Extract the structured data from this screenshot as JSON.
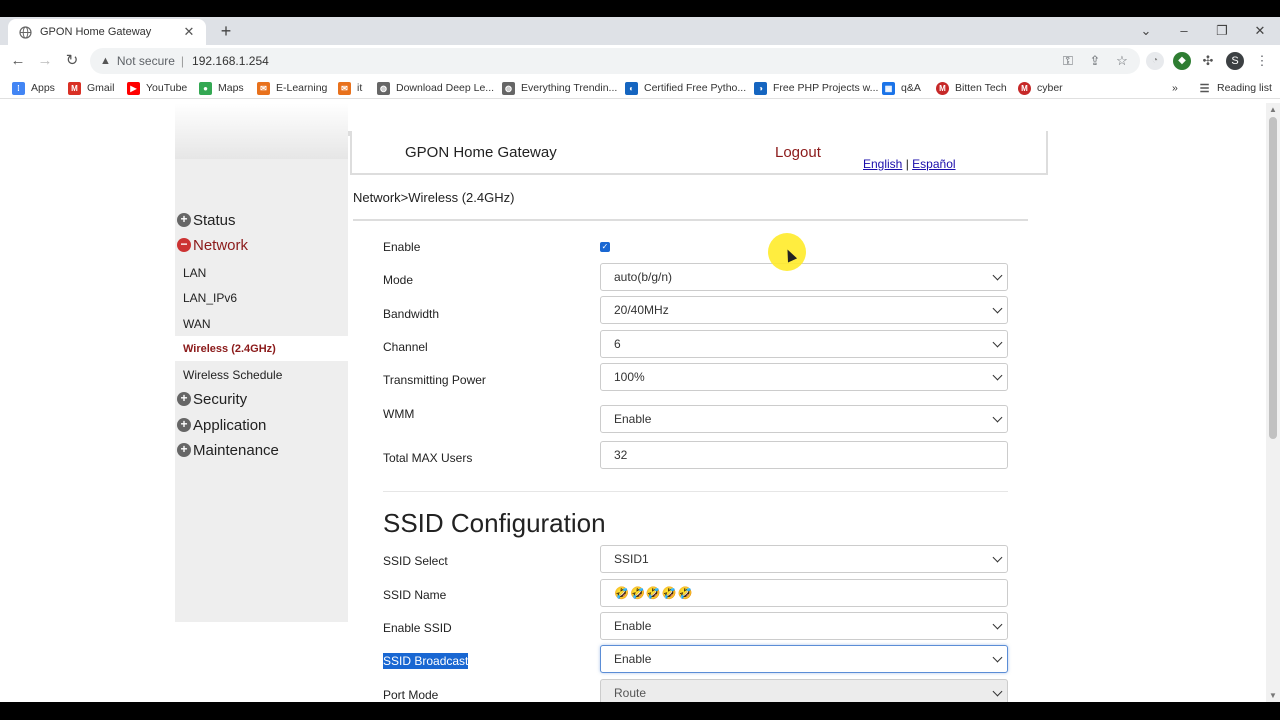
{
  "browser": {
    "tab_title": "GPON Home Gateway",
    "not_secure": "Not secure",
    "url": "192.168.1.254",
    "profile_initial": "S",
    "bookmarks": [
      {
        "label": "Apps",
        "color": "#4285f4"
      },
      {
        "label": "Gmail",
        "color": "#d93025"
      },
      {
        "label": "YouTube",
        "color": "#ff0000"
      },
      {
        "label": "Maps",
        "color": "#34a853"
      },
      {
        "label": "E-Learning",
        "color": "#e8711c"
      },
      {
        "label": "it",
        "color": "#e8711c"
      },
      {
        "label": "Download Deep Le...",
        "color": "#666666"
      },
      {
        "label": "Everything Trendin...",
        "color": "#666666"
      },
      {
        "label": "Certified Free Pytho...",
        "color": "#1565c0"
      },
      {
        "label": "Free PHP Projects w...",
        "color": "#1565c0"
      },
      {
        "label": "q&A",
        "color": "#1a73e8"
      },
      {
        "label": "Bitten Tech",
        "color": "#c62828"
      },
      {
        "label": "cyber",
        "color": "#c62828"
      }
    ],
    "more_bookmarks": "»",
    "reading_list": "Reading list"
  },
  "header": {
    "brand": "GPON Home Gateway",
    "logout": "Logout",
    "lang_en": "English",
    "lang_sep": "|",
    "lang_es": "Español"
  },
  "sidebar": {
    "status": "Status",
    "network": "Network",
    "sub": {
      "lan": "LAN",
      "lan_ipv6": "LAN_IPv6",
      "wan": "WAN",
      "wireless": "Wireless (2.4GHz)",
      "schedule": "Wireless Schedule"
    },
    "security": "Security",
    "application": "Application",
    "maintenance": "Maintenance"
  },
  "breadcrumb": "Network>Wireless (2.4GHz)",
  "wireless": {
    "enable_label": "Enable",
    "enable_checked": true,
    "mode_label": "Mode",
    "mode_value": "auto(b/g/n)",
    "bandwidth_label": "Bandwidth",
    "bandwidth_value": "20/40MHz",
    "channel_label": "Channel",
    "channel_value": "6",
    "power_label": "Transmitting Power",
    "power_value": "100%",
    "wmm_label": "WMM",
    "wmm_value": "Enable",
    "max_users_label": "Total MAX Users",
    "max_users_value": "32"
  },
  "ssid": {
    "section_title": "SSID Configuration",
    "select_label": "SSID Select",
    "select_value": "SSID1",
    "name_label": "SSID Name",
    "name_value": "🤣🤣🤣🤣🤣",
    "enable_label": "Enable SSID",
    "enable_value": "Enable",
    "broadcast_label": "SSID Broadcast",
    "broadcast_value": "Enable",
    "port_mode_label": "Port Mode",
    "port_mode_value": "Route"
  }
}
